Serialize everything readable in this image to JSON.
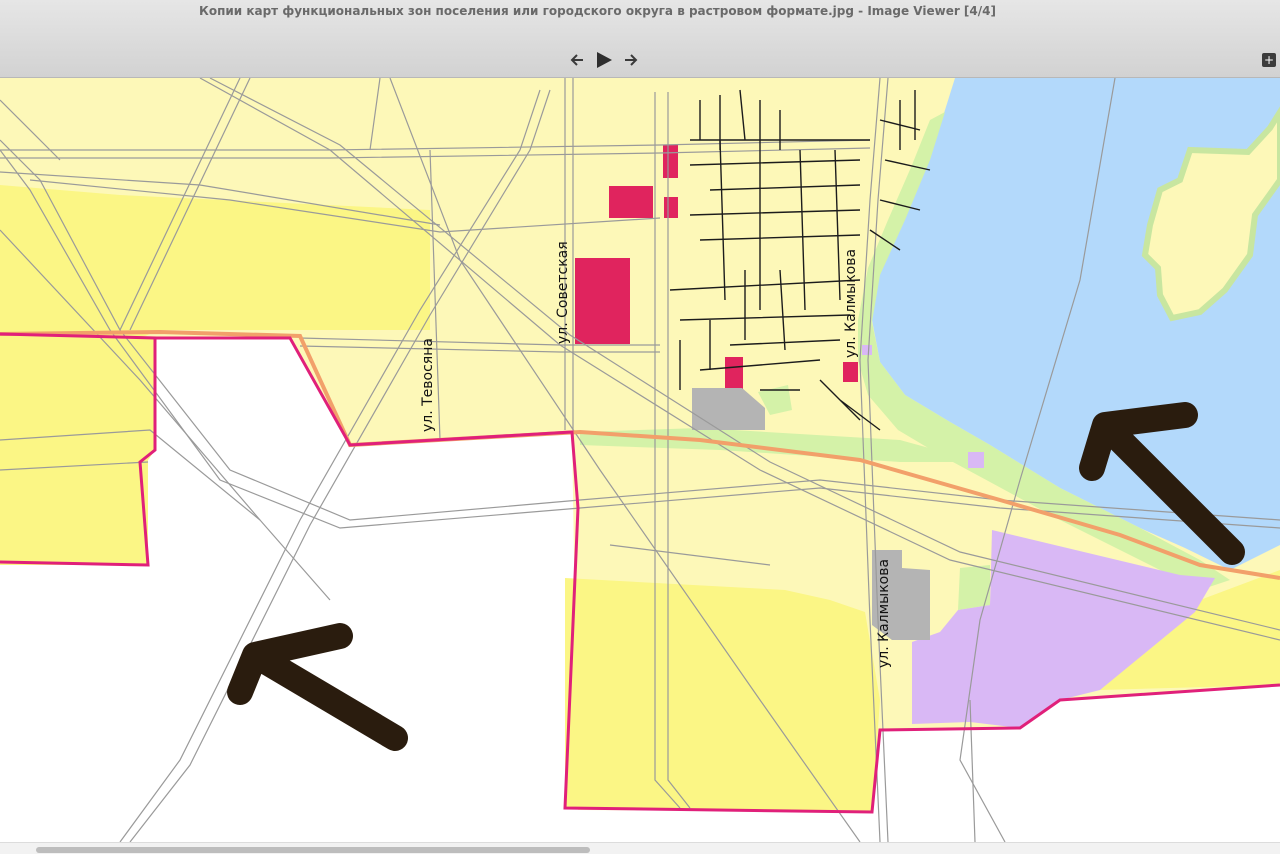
{
  "window": {
    "title": "Копии карт функциональных зон поселения или городского округа в растровом формате.jpg - Image Viewer [4/4]"
  },
  "toolbar": {
    "prev_icon": "arrow-left-icon",
    "play_icon": "play-icon",
    "next_icon": "arrow-right-icon",
    "expand_icon": "plus-icon"
  },
  "map": {
    "street_labels": {
      "tevosyana": "ул. Тевосяна",
      "sovetskaya": "ул. Советская",
      "kalmykova_upper": "ул. Калмыкова",
      "kalmykova_lower": "ул. Калмыкова"
    },
    "colors": {
      "water": "#b3d9fb",
      "residential": "#fdf8b8",
      "agricultural": "#fbf685",
      "public_business": "#e0245e",
      "industrial": "#d9b8f5",
      "green": "#d4f2a8",
      "boundary": "#e0207a",
      "railway": "#f2a06a",
      "parking": "#b4b4b4"
    },
    "annotation_arrows": 2
  }
}
